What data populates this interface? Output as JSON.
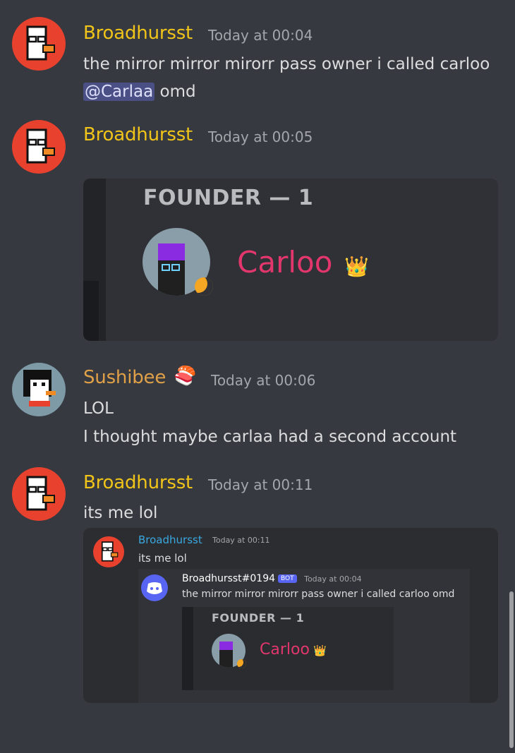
{
  "messages": [
    {
      "username": "Broadhursst",
      "timestamp": "Today at 00:04",
      "line1": "the mirror mirror mirorr pass owner i called carloo",
      "mention": "@Carlaa",
      "line2_rest": " omd"
    },
    {
      "username": "Broadhursst",
      "timestamp": "Today at 00:05"
    },
    {
      "username": "Sushibee",
      "emoji": "🍣",
      "timestamp": "Today at 00:06",
      "line1": "LOL",
      "line2": "I thought maybe carlaa had a second account"
    },
    {
      "username": "Broadhursst",
      "timestamp": "Today at 00:11",
      "line1": "its me lol"
    }
  ],
  "embed_main": {
    "header": "FOUNDER — 1",
    "name": "Carloo",
    "crown": "👑"
  },
  "nested_reply": {
    "username": "Broadhursst",
    "timestamp": "Today at 00:11",
    "text": "its me lol",
    "inner": {
      "username": "Broadhursst#0194",
      "bot_badge": "BOT",
      "timestamp": "Today at 00:04",
      "text": "the mirror mirror mirorr pass owner i called carloo omd",
      "embed": {
        "header": "FOUNDER — 1",
        "name": "Carloo",
        "crown": "👑"
      }
    }
  },
  "colors": {
    "background": "#36393f",
    "username": "#f0c419",
    "sushibee": "#e0a048",
    "carloo": "#e2366c",
    "link": "#3aa8e0"
  }
}
